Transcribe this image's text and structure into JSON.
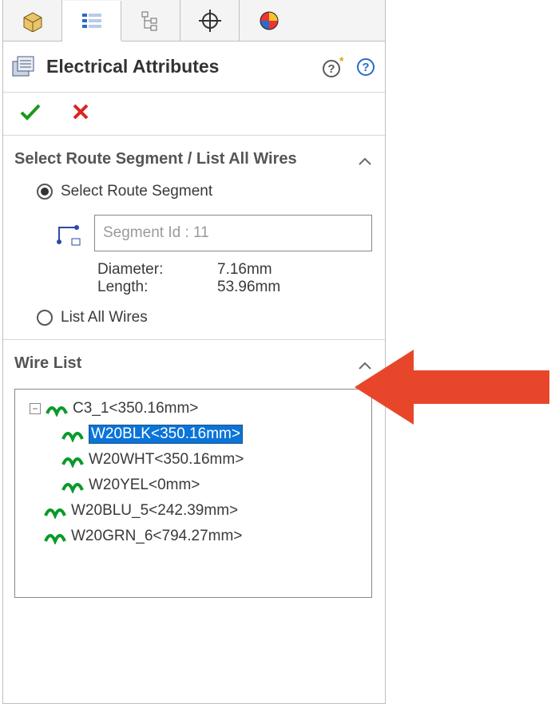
{
  "title": "Electrical Attributes",
  "sections": {
    "routeSegment": {
      "heading": "Select Route Segment / List All Wires",
      "option_select": "Select Route Segment",
      "option_list_all": "List All Wires",
      "segment_input_placeholder": "Segment Id : 11",
      "diameter_label": "Diameter:",
      "diameter_value": "7.16mm",
      "length_label": "Length:",
      "length_value": "53.96mm"
    },
    "wireList": {
      "heading": "Wire List",
      "cable": "C3_1<350.16mm>",
      "wires": [
        "W20BLK<350.16mm>",
        "W20WHT<350.16mm>",
        "W20YEL<0mm>"
      ],
      "loose_wires": [
        "W20BLU_5<242.39mm>",
        "W20GRN_6<794.27mm>"
      ]
    }
  },
  "icons": {
    "help_tip": "?*",
    "help": "?"
  }
}
